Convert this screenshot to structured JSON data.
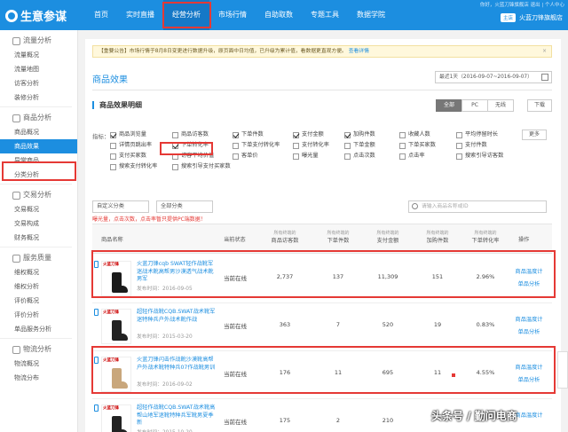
{
  "header": {
    "logo": "生意参谋",
    "nav": [
      "首页",
      "实时直播",
      "经营分析",
      "市场行情",
      "自助取数",
      "专题工具",
      "数据学院"
    ],
    "top_right": "你好，火蓝刀锋旗舰店   退出  |  个人中心",
    "shop_badge": "主店",
    "shop_name": "火蓝刀锋旗舰店"
  },
  "sidebar": [
    {
      "group": "流量分析",
      "items": [
        "流量概况",
        "流量地图",
        "访客分析",
        "装修分析"
      ]
    },
    {
      "group": "商品分析",
      "items": [
        "商品概况",
        "商品效果",
        "异常商品",
        "分类分析"
      ]
    },
    {
      "group": "交易分析",
      "items": [
        "交易概况",
        "交易构成",
        "财务概况"
      ]
    },
    {
      "group": "服务质量",
      "items": [
        "维权概况",
        "维权分析",
        "评价概况",
        "评价分析",
        "单品服务分析"
      ]
    },
    {
      "group": "物流分析",
      "items": [
        "物流概况",
        "物流分布"
      ]
    }
  ],
  "notice": {
    "text": "【重要公告】市场行情于8月8日变更进行数据升级，原页面中日均值，已升级为累计值，看数据更直观方便。",
    "link": "查看详情",
    "close": "×"
  },
  "page_title": "商品效果",
  "date_range": "最近1天（2016-09-07~2016-09-07）",
  "section_title": "商品效果明细",
  "device_tabs": [
    "全部",
    "PC",
    "无线"
  ],
  "download": "下载",
  "metrics": {
    "label": "指标：",
    "more": "更多",
    "rows": [
      [
        {
          "t": "商品浏览量",
          "on": true
        },
        {
          "t": "商品访客数",
          "on": false
        },
        {
          "t": "下单件数",
          "on": true
        },
        {
          "t": "支付金额",
          "on": true
        },
        {
          "t": "加购件数",
          "on": true
        },
        {
          "t": "收藏人数",
          "on": false
        },
        {
          "t": "平均停留时长",
          "on": false
        }
      ],
      [
        {
          "t": "详情页跳出率",
          "on": false
        },
        {
          "t": "下单转化率",
          "on": true
        },
        {
          "t": "下单支付转化率",
          "on": false
        },
        {
          "t": "支付转化率",
          "on": false
        },
        {
          "t": "下单金额",
          "on": false
        },
        {
          "t": "下单买家数",
          "on": false
        },
        {
          "t": "支付件数",
          "on": false
        }
      ],
      [
        {
          "t": "支付买家数",
          "on": false
        },
        {
          "t": "访客平均价值",
          "on": false
        },
        {
          "t": "客单价",
          "on": false
        },
        {
          "t": "曝光量",
          "on": false
        },
        {
          "t": "点击次数",
          "on": false
        },
        {
          "t": "点击率",
          "on": false
        },
        {
          "t": "搜索引导访客数",
          "on": false
        }
      ],
      [
        {
          "t": "搜索支付转化率",
          "on": false
        },
        {
          "t": "搜索引导支付买家数",
          "on": false
        }
      ]
    ],
    "tip": "曝光量，点击次数，点击率暂只提供PC端数据！"
  },
  "filters": {
    "category_a": "自定义分类",
    "category_b": "全部分类",
    "search_placeholder": "请输入商品名称或ID"
  },
  "table": {
    "headers": [
      {
        "label": "商品名称",
        "sub": ""
      },
      {
        "label": "当前状态",
        "sub": ""
      },
      {
        "label": "商品访客数",
        "sub": "所有终端的"
      },
      {
        "label": "下单件数",
        "sub": "所有终端的"
      },
      {
        "label": "支付金额",
        "sub": "所有终端的"
      },
      {
        "label": "加购件数",
        "sub": "所有终端的"
      },
      {
        "label": "下单转化率",
        "sub": "所有终端的"
      },
      {
        "label": "操作",
        "sub": ""
      }
    ],
    "rows": [
      {
        "name": "火蓝刀锋cqb SWAT轻作战靴军迷战术靴高帮男沙漠透气战术靴男军",
        "time": "发布时间：2016-09-05",
        "status": "当前在线",
        "visitors": "2,737",
        "orders": "137",
        "pay": "11,309",
        "cart": "151",
        "rate": "2.96%",
        "op1": "商品温度计",
        "op2": "单品分析",
        "boot_color": "#1b1b1b",
        "brand": "火蓝刀锋"
      },
      {
        "name": "超轻作战靴CQB.SWAT战术靴军迷特种兵户外战术靴作战",
        "time": "发布时间：2015-03-20",
        "status": "当前在线",
        "visitors": "363",
        "orders": "7",
        "pay": "520",
        "cart": "19",
        "rate": "0.83%",
        "op1": "商品温度计",
        "op2": "单品分析",
        "boot_color": "#222222",
        "brand": "火蓝刀锋"
      },
      {
        "name": "火蓝刀锋闪击作战靴沙漠靴高帮户外战术靴特种兵07作战靴男训",
        "time": "发布时间：2016-09-02",
        "status": "当前在线",
        "visitors": "176",
        "orders": "11",
        "pay": "695",
        "cart": "11",
        "rate": "4.55%",
        "op1": "商品温度计",
        "op2": "单品分析",
        "boot_color": "#c9a77c",
        "brand": "火蓝刀锋"
      },
      {
        "name": "超轻作战靴CQB.SWAT战术靴高帮山地军迷靴特种兵军靴男夏季新",
        "time": "发布时间：2015-10-20",
        "status": "当前在线",
        "visitors": "175",
        "orders": "2",
        "pay": "210",
        "cart": "",
        "rate": "",
        "op1": "商品温度计",
        "op2": "",
        "boot_color": "#222222",
        "brand": "火蓝刀锋"
      }
    ]
  },
  "watermark": "头条号 / 勤问电商"
}
